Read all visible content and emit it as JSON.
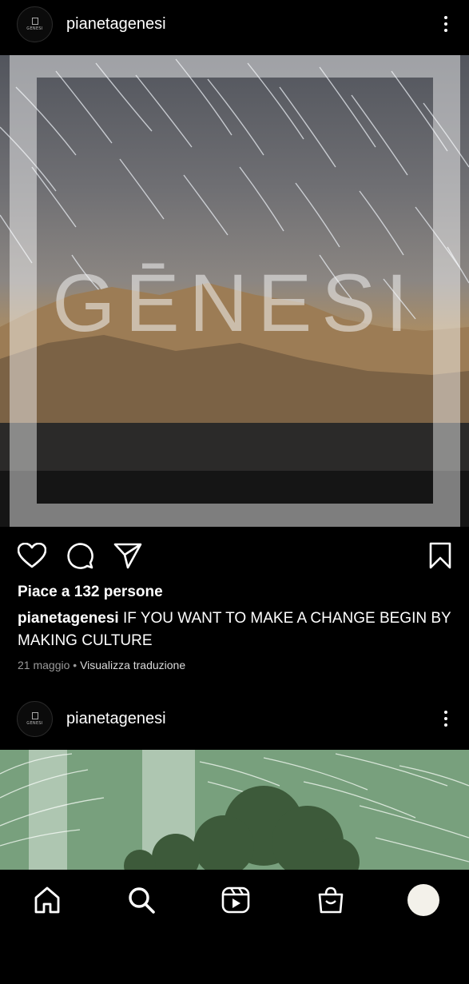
{
  "post1": {
    "username": "pianetagenesi",
    "avatar_text": "GENESI",
    "image_title": "GĒNESI",
    "likes": "Piace a 132 persone",
    "caption_user": "pianetagenesi",
    "caption_text": "IF YOU WANT TO MAKE A CHANGE BEGIN BY MAKING CULTURE",
    "date": "21 maggio",
    "separator": " • ",
    "translate": "Visualizza traduzione"
  },
  "post2": {
    "username": "pianetagenesi",
    "avatar_text": "GENESI"
  },
  "icons": {
    "like": "heart-icon",
    "comment": "comment-icon",
    "share": "send-icon",
    "save": "bookmark-icon",
    "more": "more-vertical-icon",
    "home": "home-icon",
    "search": "search-icon",
    "reels": "reels-icon",
    "shop": "shop-icon",
    "profile": "profile-avatar"
  },
  "colors": {
    "background": "#000000",
    "text": "#ffffff",
    "meta_text": "#9a9a9a",
    "post2_tint": "#7aa07e"
  }
}
